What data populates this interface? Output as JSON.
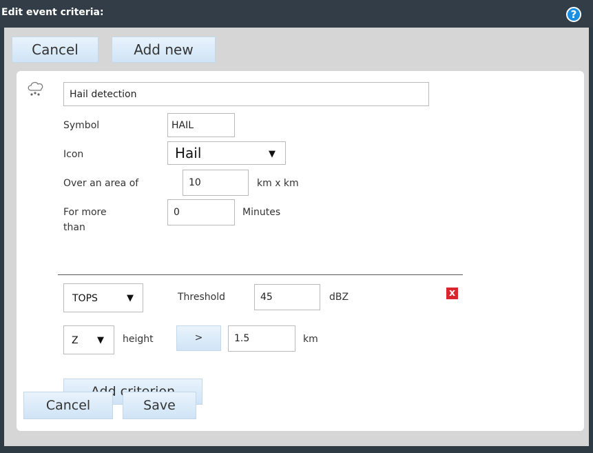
{
  "titlebar": {
    "title": "Edit event criteria:",
    "help_icon": "?"
  },
  "top_buttons": {
    "cancel": "Cancel",
    "add_new": "Add new"
  },
  "event": {
    "name_value": "Hail detection",
    "symbol_label": "Symbol",
    "symbol_value": "HAIL",
    "icon_label": "Icon",
    "icon_value": "Hail",
    "area_label": "Over an area of",
    "area_value": "10",
    "area_unit": "km x km",
    "duration_label_line1": "For more",
    "duration_label_line2": "than",
    "duration_value": "0",
    "duration_unit": "Minutes"
  },
  "criterion": {
    "product_value": "TOPS",
    "threshold_label": "Threshold",
    "threshold_value": "45",
    "threshold_unit": "dBZ",
    "remove_label": "x",
    "height_product_value": "Z",
    "height_label": "height",
    "operator_label": ">",
    "height_value": "1.5",
    "height_unit": "km"
  },
  "add_criterion_label": "Add criterion",
  "bottom_buttons": {
    "cancel": "Cancel",
    "save": "Save"
  },
  "icons": {
    "event_icon": "hail-cloud-icon",
    "dropdown": "triangle-down-icon",
    "help": "help-circle-icon",
    "remove": "close-icon"
  },
  "colors": {
    "titlebar": "#333d47",
    "help": "#1a8ee0",
    "remove": "#d9262e",
    "button_top": "#e9f3fc",
    "button_bottom": "#cfe4f6"
  }
}
